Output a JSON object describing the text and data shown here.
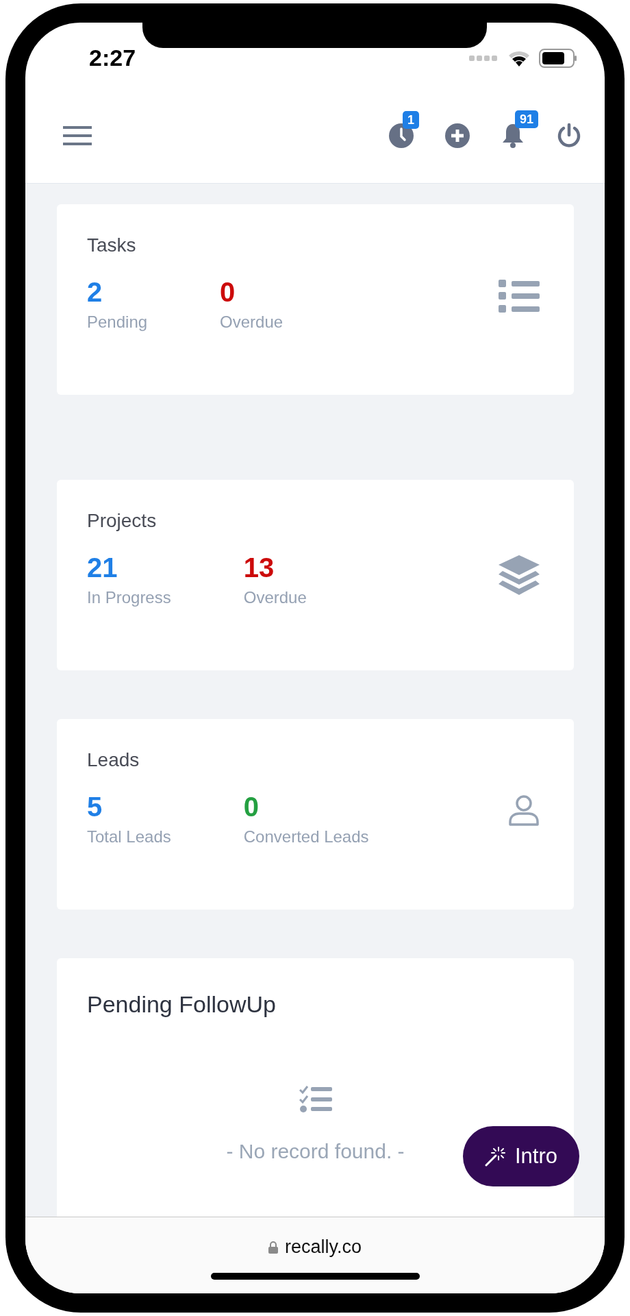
{
  "status_bar": {
    "time": "2:27"
  },
  "header": {
    "actions": [
      {
        "kind": "clock",
        "badge": "1"
      },
      {
        "kind": "add"
      },
      {
        "kind": "bell",
        "badge": "91"
      },
      {
        "kind": "power"
      }
    ]
  },
  "cards": [
    {
      "title": "Tasks",
      "kind": "list",
      "stats": [
        {
          "value": "2",
          "label": "Pending",
          "color": "#1f7fe6"
        },
        {
          "value": "0",
          "label": "Overdue",
          "color": "#cc0a0a"
        }
      ]
    },
    {
      "title": "Projects",
      "kind": "layers",
      "stats": [
        {
          "value": "21",
          "label": "In Progress",
          "color": "#1f7fe6"
        },
        {
          "value": "13",
          "label": "Overdue",
          "color": "#cc0a0a"
        }
      ]
    },
    {
      "title": "Leads",
      "kind": "user",
      "stats": [
        {
          "value": "5",
          "label": "Total Leads",
          "color": "#1f7fe6"
        },
        {
          "value": "0",
          "label": "Converted Leads",
          "color": "#24a041"
        }
      ]
    }
  ],
  "followup": {
    "title": "Pending FollowUp",
    "empty_text": "- No record found. -"
  },
  "intro_button": {
    "label": "Intro"
  },
  "browser_bar": {
    "url": "recally.co"
  }
}
